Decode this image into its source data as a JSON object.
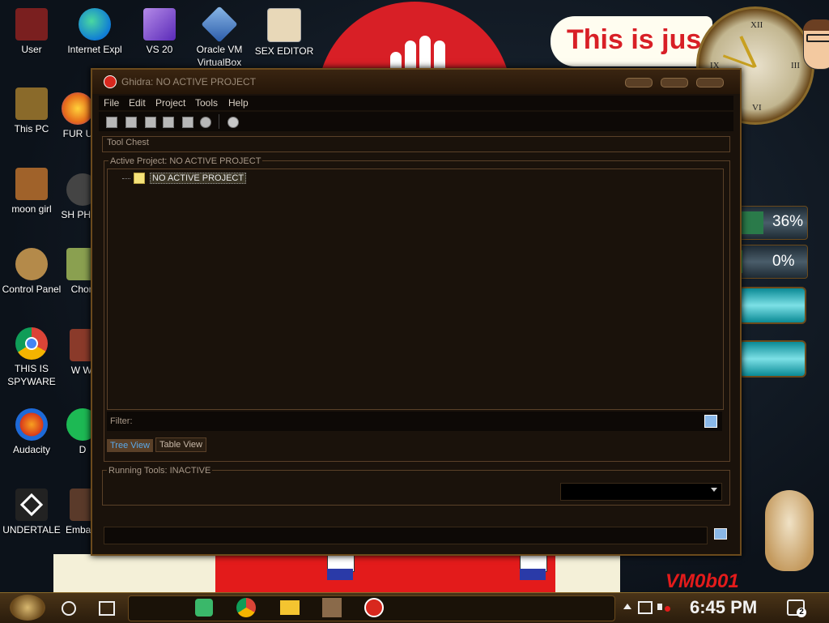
{
  "desktop": {
    "speech_text": "This is jus",
    "watermark": "VM0b01",
    "icons_col1": [
      {
        "label": "User",
        "icon": "user-folder-icon",
        "color": "#7a1f1f"
      },
      {
        "label": "This PC",
        "icon": "computer-icon",
        "color": "#8a6a2a"
      },
      {
        "label": "moon girl",
        "icon": "folder-icon",
        "color": "#a0622a"
      },
      {
        "label": "Control Panel",
        "icon": "lightbulb-icon",
        "color": "#b48a4a"
      },
      {
        "label": "THIS IS SPYWARE",
        "icon": "chrome-icon",
        "color": "#db4437"
      },
      {
        "label": "Audacity",
        "icon": "audacity-icon",
        "color": "#1e6ad8"
      },
      {
        "label": "UNDERTALE",
        "icon": "unity-icon",
        "color": "#333333"
      }
    ],
    "icons_col2": [
      {
        "label": "Internet Expl",
        "icon": "edge-icon",
        "color": "#0f7cd6"
      },
      {
        "label": "FUR U",
        "icon": "firefox-icon",
        "color": "#e66a1a"
      },
      {
        "label": "SH PHOT",
        "icon": "camera-icon",
        "color": "#555555"
      },
      {
        "label": "Chon",
        "icon": "app-icon",
        "color": "#8aa050"
      },
      {
        "label": "W Wre",
        "icon": "app-icon",
        "color": "#8a3a2a"
      },
      {
        "label": "D",
        "icon": "spotify-icon",
        "color": "#1db954"
      },
      {
        "label": "Emba De",
        "icon": "app-icon",
        "color": "#5a3a2a"
      }
    ],
    "icons_top": [
      {
        "label": "VS 20",
        "icon": "visual-studio-icon",
        "color": "#7b4ad8"
      },
      {
        "label": "Oracle VM VirtualBox",
        "icon": "virtualbox-icon",
        "color": "#2a5aa8"
      },
      {
        "label": "SEX EDITOR",
        "icon": "hxd-icon",
        "color": "#e8d8b8"
      }
    ],
    "gauges": [
      {
        "label": "36%",
        "value": 0.36,
        "color": "#2a7a4a"
      },
      {
        "label": "0%",
        "value": 0.0,
        "color": "#2a9a4a"
      }
    ]
  },
  "window": {
    "title": "Ghidra: NO ACTIVE PROJECT",
    "menus": [
      "File",
      "Edit",
      "Project",
      "Tools",
      "Help"
    ],
    "toolbar": [
      "new-project-icon",
      "open-project-icon",
      "close-project-icon",
      "save-project-icon",
      "delete-project-icon",
      "archive-project-icon",
      "refresh-icon"
    ],
    "tool_chest_label": "Tool Chest",
    "active_project_label": "Active Project: NO ACTIVE PROJECT",
    "tree_node": "NO ACTIVE PROJECT",
    "filter_label": "Filter:",
    "filter_value": "",
    "tabs": {
      "tree": "Tree View",
      "table": "Table View",
      "selected": "Tree View"
    },
    "running_tools_label": "Running Tools: INACTIVE",
    "workspace_value": ""
  },
  "taskbar": {
    "pinned": [
      "steampunk-start-icon",
      "search-icon",
      "task-view-icon"
    ],
    "apps": [
      "notes-app-icon",
      "chrome-icon",
      "file-explorer-icon",
      "photo-app-icon",
      "ghidra-icon"
    ],
    "time": "6:45 PM",
    "notification_count": "2",
    "tray_icons": [
      "chevron-up-icon",
      "network-icon",
      "volume-muted-icon",
      "notification-icon"
    ]
  }
}
